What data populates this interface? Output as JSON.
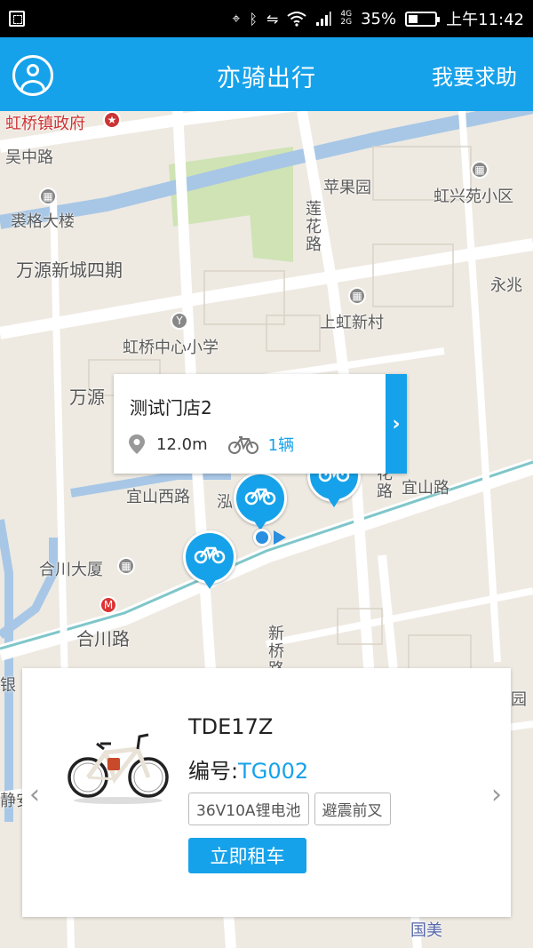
{
  "status_bar": {
    "battery_percent": "35%",
    "battery_level": 0.35,
    "time": "上午11:42",
    "network_top": "4G",
    "network_bottom": "2G",
    "icons": [
      "screenshot-icon",
      "location-icon",
      "bluetooth-icon",
      "vibrate-icon",
      "wifi-icon",
      "signal-icon",
      "battery-icon"
    ]
  },
  "header": {
    "title": "亦骑出行",
    "help": "我要求助",
    "avatar_icon": "user-icon"
  },
  "map": {
    "labels": [
      {
        "text": "虹桥镇政府",
        "style": "red"
      },
      {
        "text": "吴中路"
      },
      {
        "text": "苹果园"
      },
      {
        "text": "虹兴苑小区"
      },
      {
        "text": "裘格大楼"
      },
      {
        "text": "莲花路"
      },
      {
        "text": "万源新城四期"
      },
      {
        "text": "永兆"
      },
      {
        "text": "上虹新村"
      },
      {
        "text": "虹桥中心小学"
      },
      {
        "text": "万源"
      },
      {
        "text": "宜山西路"
      },
      {
        "text": "宜山路"
      },
      {
        "text": "泓"
      },
      {
        "text": "花路"
      },
      {
        "text": "合川大厦"
      },
      {
        "text": "合川路"
      },
      {
        "text": "新桥路"
      },
      {
        "text": "银"
      },
      {
        "text": "静安"
      },
      {
        "text": "国美"
      },
      {
        "text": "园"
      }
    ],
    "markers": [
      "bike-marker",
      "bike-marker",
      "bike-marker"
    ]
  },
  "store_popup": {
    "name": "测试门店2",
    "distance": "12.0m",
    "count": "1辆",
    "arrow": "›"
  },
  "bike_card": {
    "model": "TDE17Z",
    "code_label": "编号:",
    "code_value": "TG002",
    "tags": [
      "36V10A锂电池",
      "避震前叉"
    ],
    "rent_button": "立即租车",
    "prev": "‹",
    "next": "›"
  },
  "colors": {
    "accent": "#16a2ea",
    "status_bar": "#000000"
  }
}
